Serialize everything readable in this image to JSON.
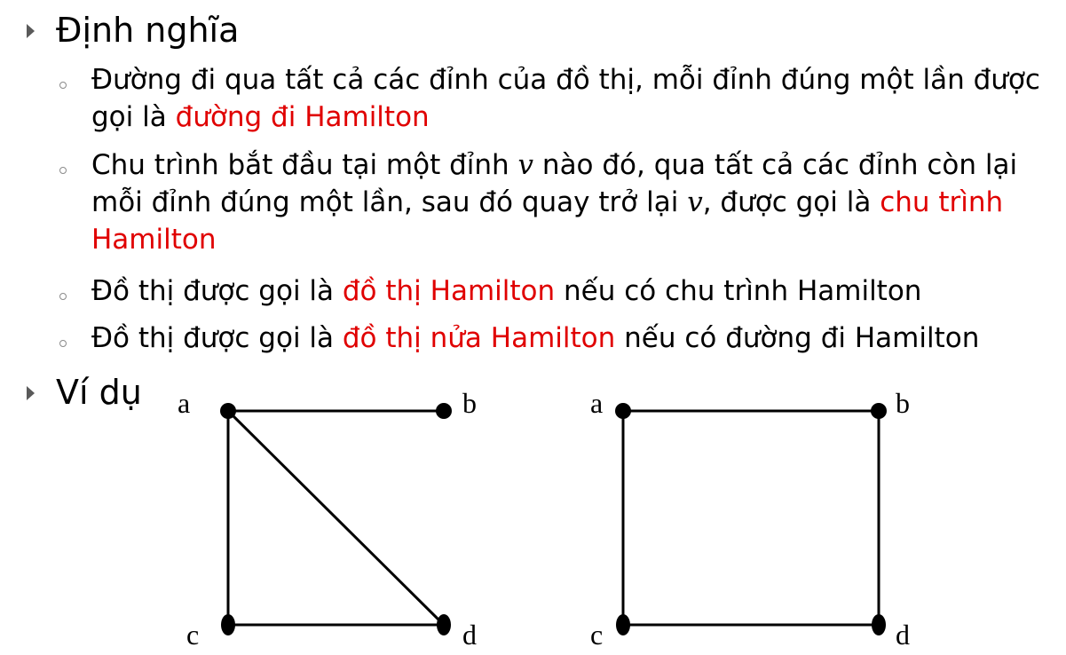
{
  "definition": {
    "title": "Định nghĩa",
    "items": [
      {
        "before": "Đường đi qua tất cả các đỉnh của đồ thị, mỗi đỉnh đúng một lần được gọi là ",
        "highlight": "đường đi Hamilton"
      },
      {
        "part1": "Chu trình bắt đầu tại một đỉnh ",
        "var1": "v",
        "part2": " nào đó, qua tất cả các đỉnh còn lại mỗi đỉnh đúng một lần, sau đó quay trở lại ",
        "var2": "v",
        "part3": ", được gọi là ",
        "highlight": "chu trình Hamilton"
      },
      {
        "before": "Đồ thị được gọi là ",
        "highlight": "đồ thị Hamilton",
        "after": " nếu có chu trình Hamilton"
      },
      {
        "before": "Đồ thị được gọi là ",
        "highlight": "đồ thị nửa Hamilton",
        "after": " nếu có đường đi Hamilton"
      }
    ]
  },
  "example": {
    "title": "Ví dụ"
  },
  "graphs": [
    {
      "vertices": [
        "a",
        "b",
        "c",
        "d"
      ],
      "edges": [
        [
          "a",
          "b"
        ],
        [
          "a",
          "c"
        ],
        [
          "a",
          "d"
        ],
        [
          "c",
          "d"
        ]
      ]
    },
    {
      "vertices": [
        "a",
        "b",
        "c",
        "d"
      ],
      "edges": [
        [
          "a",
          "b"
        ],
        [
          "a",
          "c"
        ],
        [
          "b",
          "d"
        ],
        [
          "c",
          "d"
        ]
      ]
    }
  ],
  "colors": {
    "highlight": "#e00000",
    "bullet": "#5a5a5a"
  }
}
